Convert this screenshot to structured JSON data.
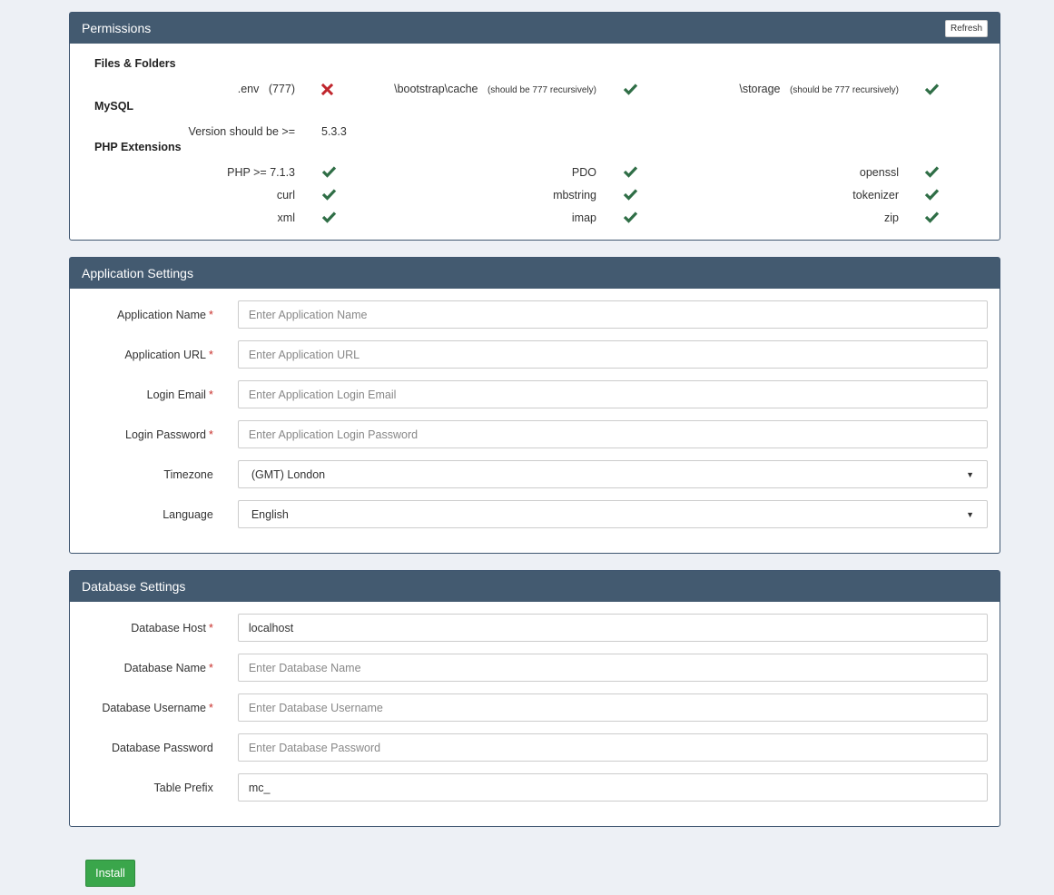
{
  "permissions": {
    "title": "Permissions",
    "refresh_label": "Refresh",
    "files_title": "Files & Folders",
    "files": [
      {
        "name": ".env",
        "note": "(777)",
        "status": "fail"
      },
      {
        "name": "\\bootstrap\\cache",
        "note": "(should be 777 recursively)",
        "status": "ok"
      },
      {
        "name": "\\storage",
        "note": "(should be 777 recursively)",
        "status": "ok"
      }
    ],
    "mysql_title": "MySQL",
    "mysql_label": "Version should be >=",
    "mysql_version": "5.3.3",
    "php_title": "PHP Extensions",
    "extensions": [
      "PHP >= 7.1.3",
      "PDO",
      "openssl",
      "curl",
      "mbstring",
      "tokenizer",
      "xml",
      "imap",
      "zip"
    ]
  },
  "app": {
    "title": "Application Settings",
    "name_label": "Application Name",
    "name_placeholder": "Enter Application Name",
    "url_label": "Application URL",
    "url_placeholder": "Enter Application URL",
    "email_label": "Login Email",
    "email_placeholder": "Enter Application Login Email",
    "password_label": "Login Password",
    "password_placeholder": "Enter Application Login Password",
    "timezone_label": "Timezone",
    "timezone_value": "(GMT) London",
    "language_label": "Language",
    "language_value": "English",
    "required_mark": "*"
  },
  "db": {
    "title": "Database Settings",
    "host_label": "Database Host",
    "host_value": "localhost",
    "name_label": "Database Name",
    "name_placeholder": "Enter Database Name",
    "username_label": "Database Username",
    "username_placeholder": "Enter Database Username",
    "password_label": "Database Password",
    "password_placeholder": "Enter Database Password",
    "prefix_label": "Table Prefix",
    "prefix_value": "mc_"
  },
  "install_label": "Install",
  "colors": {
    "ok": "#2f6e46",
    "fail": "#c0262d",
    "header": "#435a70",
    "install": "#3aa64b"
  },
  "icons": {
    "ok": "check-icon",
    "fail": "cross-icon"
  }
}
